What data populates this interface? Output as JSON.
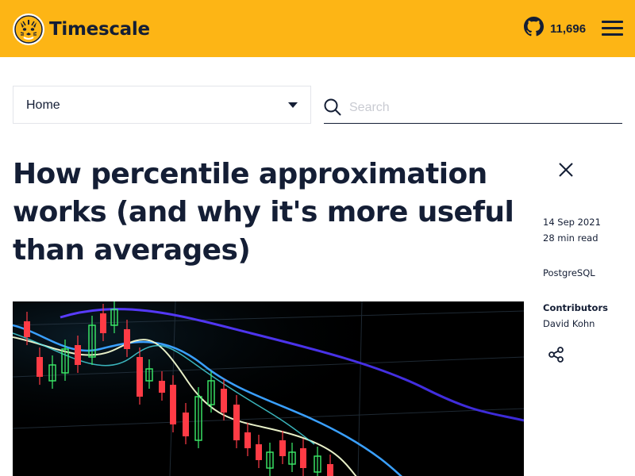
{
  "header": {
    "brand": "Timescale",
    "github_stars": "11,696",
    "colors": {
      "background": "#fdb515",
      "text": "#141e35"
    },
    "icons": [
      "tiger-logo-icon",
      "github-icon",
      "hamburger-menu-icon"
    ]
  },
  "nav": {
    "select_value": "Home",
    "search_placeholder": "Search"
  },
  "article": {
    "title": "How percentile approximation works (and why it's more useful than averages)",
    "date": "14 Sep 2021",
    "read_time": "28 min read",
    "tag": "PostgreSQL",
    "contributors_label": "Contributors",
    "contributor": "David Kohn",
    "hero_image": "candlestick stock chart with moving average lines on black background"
  }
}
